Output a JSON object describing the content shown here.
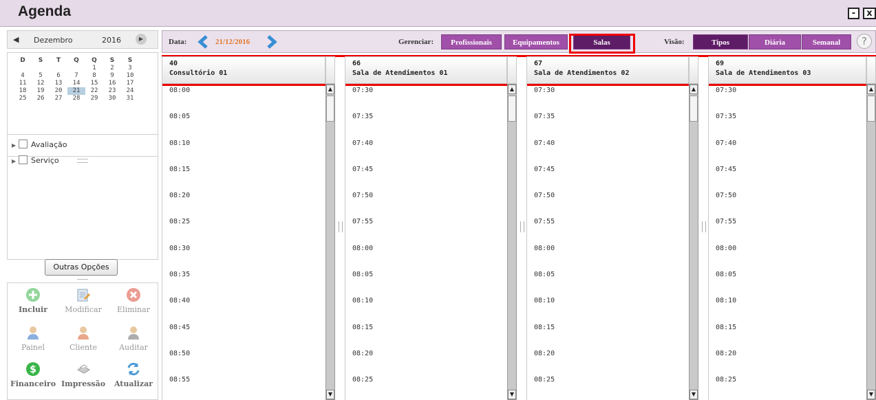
{
  "window": {
    "title": "Agenda",
    "minimize": "-",
    "close": "x"
  },
  "calendar": {
    "prev": "◀",
    "month": "Dezembro",
    "year": "2016",
    "next": "▶",
    "weekdays": [
      "D",
      "S",
      "T",
      "Q",
      "Q",
      "S",
      "S"
    ],
    "days": [
      "",
      "",
      "",
      "",
      "1",
      "2",
      "3",
      "4",
      "5",
      "6",
      "7",
      "8",
      "9",
      "10",
      "11",
      "12",
      "13",
      "14",
      "15",
      "16",
      "17",
      "18",
      "19",
      "20",
      "21",
      "22",
      "23",
      "24",
      "25",
      "26",
      "27",
      "28",
      "29",
      "30",
      "31"
    ],
    "selected_day": "21"
  },
  "tree": {
    "items": [
      {
        "label": "Avaliação"
      },
      {
        "label": "Serviço"
      }
    ]
  },
  "more_options": "Outras Opções",
  "tools": [
    {
      "label": "Incluir",
      "icon": "add-icon",
      "color": "#3bb54a",
      "bold": true
    },
    {
      "label": "Modificar",
      "icon": "edit-icon",
      "color": "#8da8c4",
      "bold": false
    },
    {
      "label": "Eliminar",
      "icon": "delete-icon",
      "color": "#e05a4a",
      "bold": false
    },
    {
      "label": "Painel",
      "icon": "panel-user-icon",
      "color": "#5a8fd0",
      "bold": false
    },
    {
      "label": "Cliente",
      "icon": "client-user-icon",
      "color": "#e0805a",
      "bold": false
    },
    {
      "label": "Auditar",
      "icon": "audit-user-icon",
      "color": "#8a8a8a",
      "bold": false
    },
    {
      "label": "Financeiro",
      "icon": "money-icon",
      "color": "#3bb54a",
      "bold": true
    },
    {
      "label": "Impressão",
      "icon": "printer-icon",
      "color": "#9a9a9a",
      "bold": true
    },
    {
      "label": "Atualizar",
      "icon": "refresh-icon",
      "color": "#4a9ad8",
      "bold": true
    }
  ],
  "toolbar": {
    "date_label": "Data:",
    "date": "21/12/2016",
    "manage_label": "Gerenciar:",
    "manage_buttons": [
      "Profissionais",
      "Equipamentos",
      "Salas"
    ],
    "view_label": "Visão:",
    "view_buttons": [
      "Tipos",
      "Diária",
      "Semanal"
    ],
    "help": "?"
  },
  "columns": [
    {
      "id": "40",
      "name": "Consultório 01",
      "times": [
        "08:00",
        "08:05",
        "08:10",
        "08:15",
        "08:20",
        "08:25",
        "08:30",
        "08:35",
        "08:40",
        "08:45",
        "08:50",
        "08:55"
      ]
    },
    {
      "id": "66",
      "name": "Sala de Atendimentos 01",
      "times": [
        "07:30",
        "07:35",
        "07:40",
        "07:45",
        "07:50",
        "07:55",
        "08:00",
        "08:05",
        "08:10",
        "08:15",
        "08:20",
        "08:25"
      ]
    },
    {
      "id": "67",
      "name": "Sala de Atendimentos 02",
      "times": [
        "07:30",
        "07:35",
        "07:40",
        "07:45",
        "07:50",
        "07:55",
        "08:00",
        "08:05",
        "08:10",
        "08:15",
        "08:20",
        "08:25"
      ]
    },
    {
      "id": "69",
      "name": "Sala de Atendimentos 03",
      "times": [
        "07:30",
        "07:35",
        "07:40",
        "07:45",
        "07:50",
        "07:55",
        "08:00",
        "08:05",
        "08:10",
        "08:15",
        "08:20",
        "08:25"
      ]
    }
  ],
  "colors": {
    "accent": "#a050a8",
    "accent_dark": "#5e1b66",
    "date": "#e0772a",
    "highlight": "#ee0000"
  }
}
